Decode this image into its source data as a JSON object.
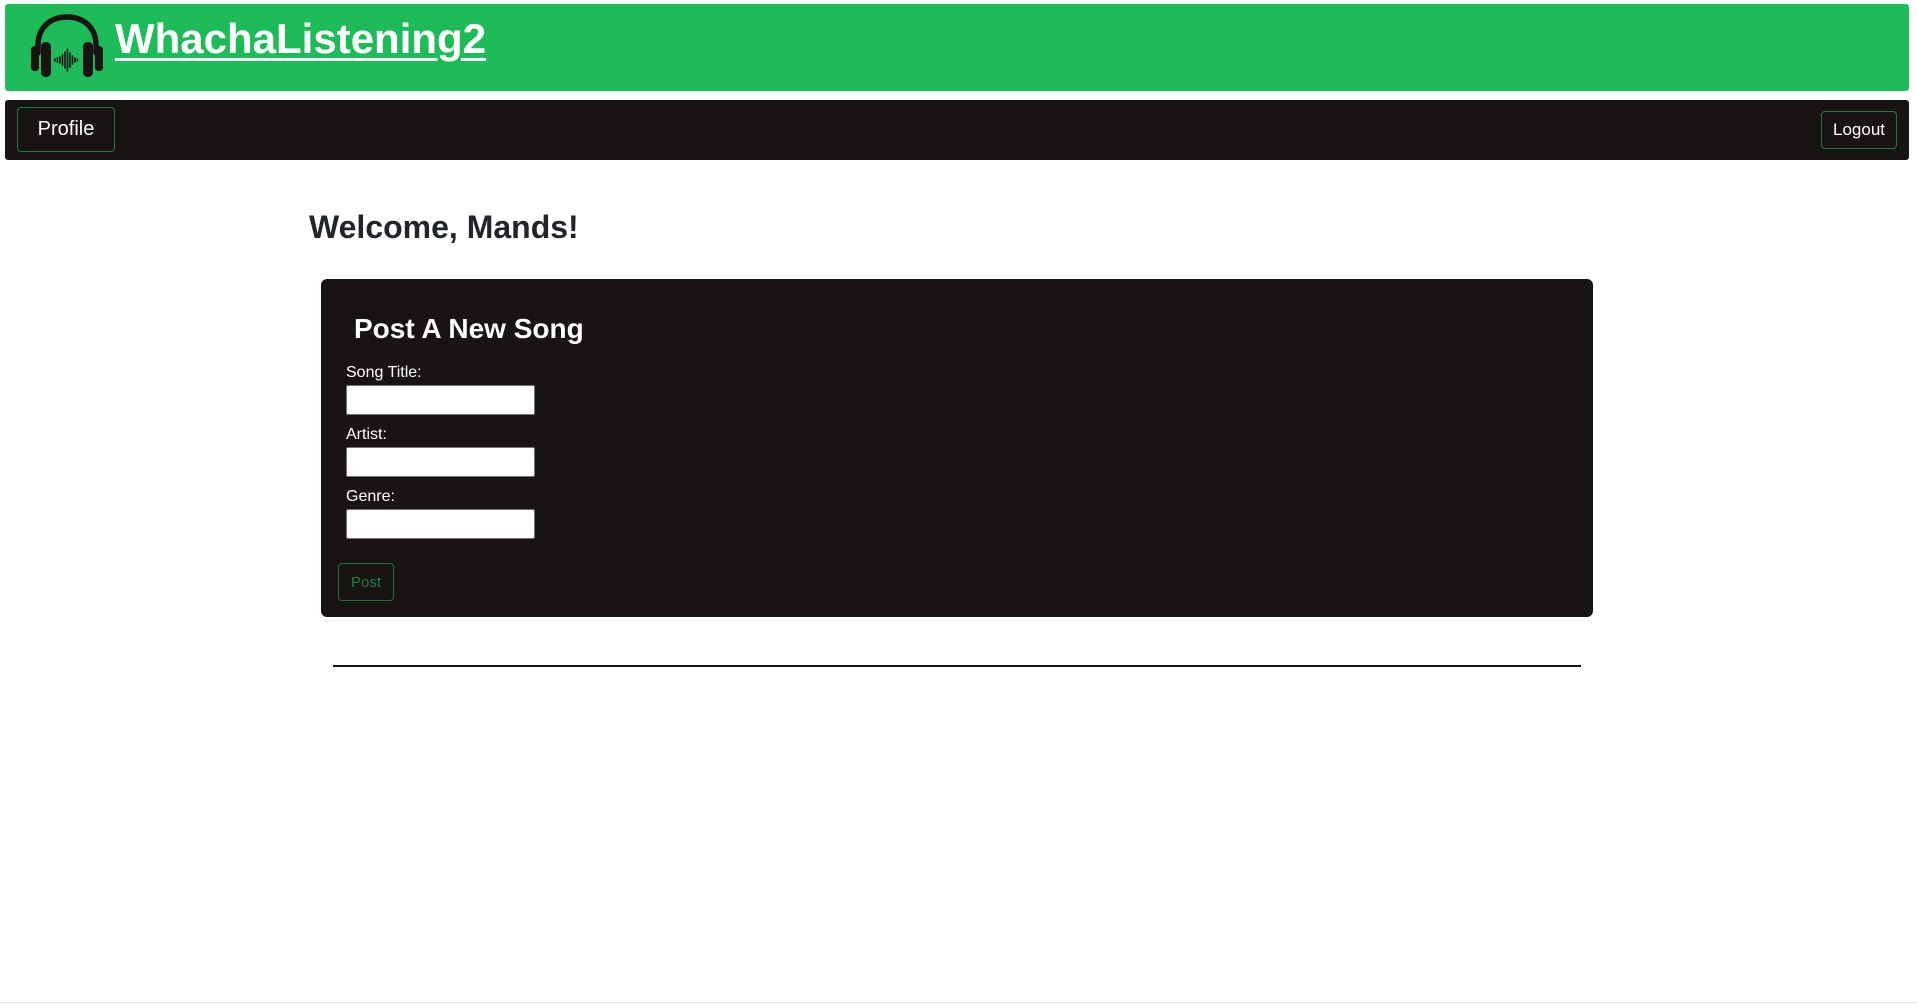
{
  "header": {
    "logo_icon": "headphones-soundwave-icon",
    "app_title": "WhachaListening2"
  },
  "nav": {
    "profile_label": "Profile",
    "logout_label": "Logout"
  },
  "main": {
    "welcome_text": "Welcome, Mands!"
  },
  "post_form": {
    "title": "Post A New Song",
    "fields": [
      {
        "label": "Song Title:",
        "value": ""
      },
      {
        "label": "Artist:",
        "value": ""
      },
      {
        "label": "Genre:",
        "value": ""
      }
    ],
    "submit_label": "Post"
  },
  "colors": {
    "brand_green": "#1ebc59",
    "dark_background": "#191414",
    "button_border_green": "#1d7a45",
    "text_light": "#ffffff",
    "text_dark": "#212529"
  }
}
